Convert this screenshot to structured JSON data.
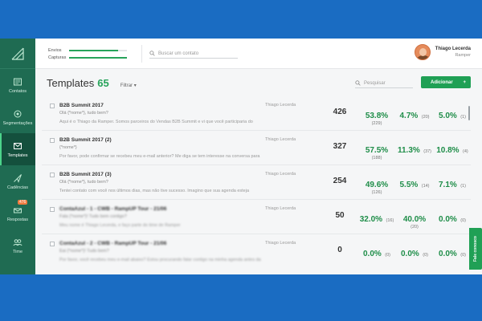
{
  "sidebar": {
    "items": [
      {
        "label": "Contatos",
        "icon": "contacts-icon"
      },
      {
        "label": "Segmentações",
        "icon": "segments-icon"
      },
      {
        "label": "Templates",
        "icon": "templates-icon",
        "active": true
      },
      {
        "label": "Cadências",
        "icon": "cadences-icon"
      },
      {
        "label": "Respostas",
        "icon": "responses-icon",
        "badge": "476"
      },
      {
        "label": "Time",
        "icon": "team-icon"
      }
    ]
  },
  "header": {
    "meters": [
      {
        "label": "Envios",
        "fraction": 0.85
      },
      {
        "label": "Capturas",
        "fraction": 1.0
      }
    ],
    "search_placeholder": "Buscar um contato",
    "user_name": "Thiago Lecerda",
    "user_company": "Ramper"
  },
  "toolbar": {
    "title": "Templates",
    "count": "65",
    "filter_label": "Filtrar",
    "search_placeholder": "Pesquisar",
    "add_label": "Adicionar",
    "add_symbol": "+"
  },
  "rows": [
    {
      "name": "B2B Summit 2017",
      "subject": "Olá {*nome*}, tudo bem?",
      "body": "Aqui é o Thiago da Ramper. Somos parceiros do Vendas B2B Summit e vi que você participaria do",
      "owner": "Thiago Lecerda",
      "sent": "426",
      "m1": {
        "pct": "53.8%",
        "count": "(229)"
      },
      "m2": {
        "pct": "4.7%",
        "count": "(20)"
      },
      "m3": {
        "pct": "5.0%",
        "count": "(1)"
      }
    },
    {
      "name": "B2B Summit 2017 (2)",
      "subject": "{*nome*}",
      "body": "Por favor, pode confirmar se recebeu meu  e-mail anterior? Me diga se tem interesse na conversa para",
      "owner": "Thiago Lecerda",
      "sent": "327",
      "m1": {
        "pct": "57.5%",
        "count": "(188)"
      },
      "m2": {
        "pct": "11.3%",
        "count": "(37)"
      },
      "m3": {
        "pct": "10.8%",
        "count": "(4)"
      }
    },
    {
      "name": "B2B Summit 2017 (3)",
      "subject": "Olá {*nome*}, tudo bem?",
      "body": "Tentei contato com você nos últimos dias, mas não tive sucesso. Imagino que sua agenda esteja",
      "owner": "Thiago Lecerda",
      "sent": "254",
      "m1": {
        "pct": "49.6%",
        "count": "(126)"
      },
      "m2": {
        "pct": "5.5%",
        "count": "(14)"
      },
      "m3": {
        "pct": "7.1%",
        "count": "(1)"
      }
    },
    {
      "name": "ContaAzul - 1 - CWB - RampUP Tour - 21/06",
      "subject": "Fala {*nome*}! Tudo bem contigo?",
      "body": "Meu nome é Thiago Lecerda, e faço parte do time de Ramper",
      "owner": "Thiago Lecerda",
      "sent": "50",
      "blur": true,
      "m1": {
        "pct": "32.0%",
        "count": "(16)"
      },
      "m2": {
        "pct": "40.0%",
        "count": "(20)",
        "stacked": true
      },
      "m3": {
        "pct": "0.0%",
        "count": "(0)"
      }
    },
    {
      "name": "ContaAzul - 2 - CWB - RampUP Tour - 21/06",
      "subject": "Eai {*nome*}! Tudo bem?",
      "body": "Por favor, você recebeu meu e-mail abaixo? Estou procurando falar contigo na minha agenda antes da",
      "owner": "Thiago Lecerda",
      "sent": "0",
      "blur": true,
      "m1": {
        "pct": "0.0%",
        "count": "(0)"
      },
      "m2": {
        "pct": "0.0%",
        "count": "(0)"
      },
      "m3": {
        "pct": "0.0%",
        "count": "(0)"
      }
    }
  ],
  "feedback_label": "Fale conosco",
  "colors": {
    "accent": "#20a055",
    "sidebar": "#1f6b52",
    "frame": "#1a6cc2"
  }
}
